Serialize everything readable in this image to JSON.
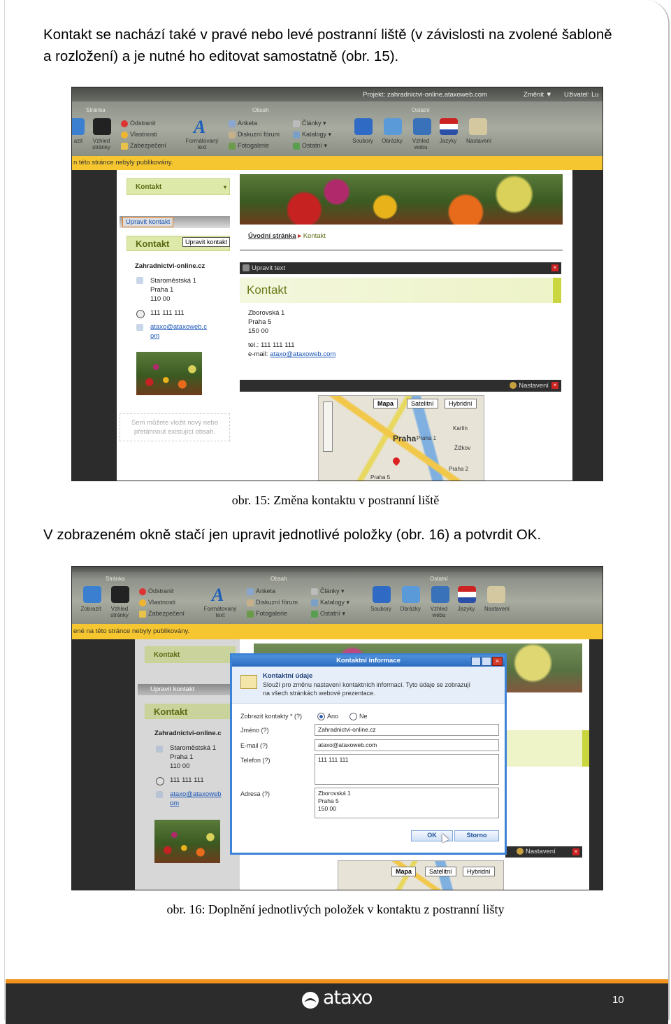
{
  "paragraph1": {
    "line1": "Kontakt se nachází také v pravé nebo levé postranní liště (v závislosti na zvolené šabloně",
    "line2": "a rozložení) a je nutné ho editovat samostatně (obr. 15)."
  },
  "figure1": {
    "caption": "obr. 15: Změna kontaktu v postranní liště",
    "toolbar": {
      "project_label": "Projekt: zahradnictvi-online.ataxoweb.com",
      "change_label": "Změnit ▼",
      "user_label": "Uživatel: Lu",
      "groups": [
        "Stránka",
        "Obsah",
        "Ostatní"
      ],
      "stranka_items": [
        "Odstranit",
        "Vlastnosti",
        "Zabezpečení"
      ],
      "stranka_big": [
        "azit",
        "Vzhled stránky"
      ],
      "obsah_big": "Formátovaný text",
      "obsah_items": [
        "Anketa",
        "Diskuzní fórum",
        "Fotogalerie"
      ],
      "obsah_items2": [
        "Články",
        "Katalogy",
        "Ostatní"
      ],
      "ostatni_items": [
        "Soubory",
        "Obrázky",
        "Vzhled webu",
        "Jazyky",
        "Nastavení"
      ]
    },
    "notice": "n této stránce nebyly publikovány.",
    "sidebar": {
      "kontakt_header": "Kontakt",
      "edit_button": "Upravit kontakt",
      "tooltip": "Upravit kontakt",
      "kontakt_title": "Kontakt",
      "company": "Zahradnictvi-online.cz",
      "address": [
        "Staroměstská 1",
        "Praha 1",
        "110 00"
      ],
      "phone": "111 111 111",
      "email_1": "ataxo@ataxoweb.c",
      "email_2": "om",
      "drop_hint_1": "Sem můžete vložit nový nebo",
      "drop_hint_2": "přetáhnout existující obsah."
    },
    "main": {
      "breadcrumb_home": "Úvodní stránka",
      "breadcrumb_current": "Kontakt",
      "edit_text_bar": "Upravit text",
      "content_title": "Kontakt",
      "address": [
        "Zborovská 1",
        "Praha 5",
        "150 00"
      ],
      "tel": "tel.: 111 111 111",
      "email_label": "e-mail:",
      "email": "ataxo@ataxoweb.com",
      "settings": "Nastavení",
      "map_tabs": [
        "Mapa",
        "Satelitní",
        "Hybridní"
      ],
      "map_labels": [
        "Praha",
        "Praha 1",
        "Karlín",
        "Žižkov",
        "Praha 2",
        "Praha 5"
      ]
    }
  },
  "paragraph2": "V zobrazeném okně stačí jen upravit jednotlivé položky (obr. 16) a potvrdit OK.",
  "figure2": {
    "caption": "obr. 16: Doplnění jednotlivých položek v kontaktu z postranní lišty",
    "toolbar": {
      "groups": [
        "Stránka",
        "Obsah",
        "Ostatní"
      ],
      "stranka_big": [
        "Zobrazit",
        "Vzhled stránky"
      ],
      "stranka_items": [
        "Odstranit",
        "Vlastnosti",
        "Zabezpečení"
      ],
      "obsah_big": "Formátovaný text",
      "obsah_items": [
        "Anketa",
        "Diskuzní fórum",
        "Fotogalerie"
      ],
      "obsah_items2": [
        "Články",
        "Katalogy",
        "Ostatní"
      ],
      "ostatni_items": [
        "Soubory",
        "Obrázky",
        "Vzhled webu",
        "Jazyky",
        "Nastavení"
      ]
    },
    "notice": "ené na této stránce nebyly publikovány.",
    "sidebar": {
      "kontakt_header": "Kontakt",
      "edit_button": "Upravit kontakt",
      "kontakt_title": "Kontakt",
      "company": "Zahradnictvi-online.c",
      "address": [
        "Staroměstská 1",
        "Praha 1",
        "110 00"
      ],
      "phone": "111 111 111",
      "email_1": "ataxo@ataxoweb",
      "email_2": "om"
    },
    "dialog": {
      "title": "Kontaktní informace",
      "heading": "Kontaktní údaje",
      "desc_1": "Slouží pro změnu nastavení kontaktních informací. Tyto údaje se zobrazují",
      "desc_2": "na všech stránkách webové prezentace.",
      "show_label": "Zobrazit kontakty * (?)",
      "opt_yes": "Ano",
      "opt_no": "Ne",
      "name_label": "Jméno (?)",
      "name_value": "Zahradnictvi-online.cz",
      "email_label": "E-mail (?)",
      "email_value": "ataxo@ataxoweb.com",
      "phone_label": "Telefon (?)",
      "phone_value": "111 111 111",
      "address_label": "Adresa (?)",
      "address_value": [
        "Zborovská 1",
        "Praha 5",
        "150 00"
      ],
      "ok": "OK",
      "cancel": "Storno"
    },
    "settings": "Nastavení",
    "map_tabs": [
      "Mapa",
      "Satelitní",
      "Hybridní"
    ]
  },
  "footer": {
    "logo": "ataxo",
    "page_number": "10"
  },
  "colors": {
    "accent_orange": "#f0921c",
    "footer_dark": "#2c2c2c",
    "notice_yellow": "#f5c630",
    "kontakt_green": "#dce9a8"
  }
}
